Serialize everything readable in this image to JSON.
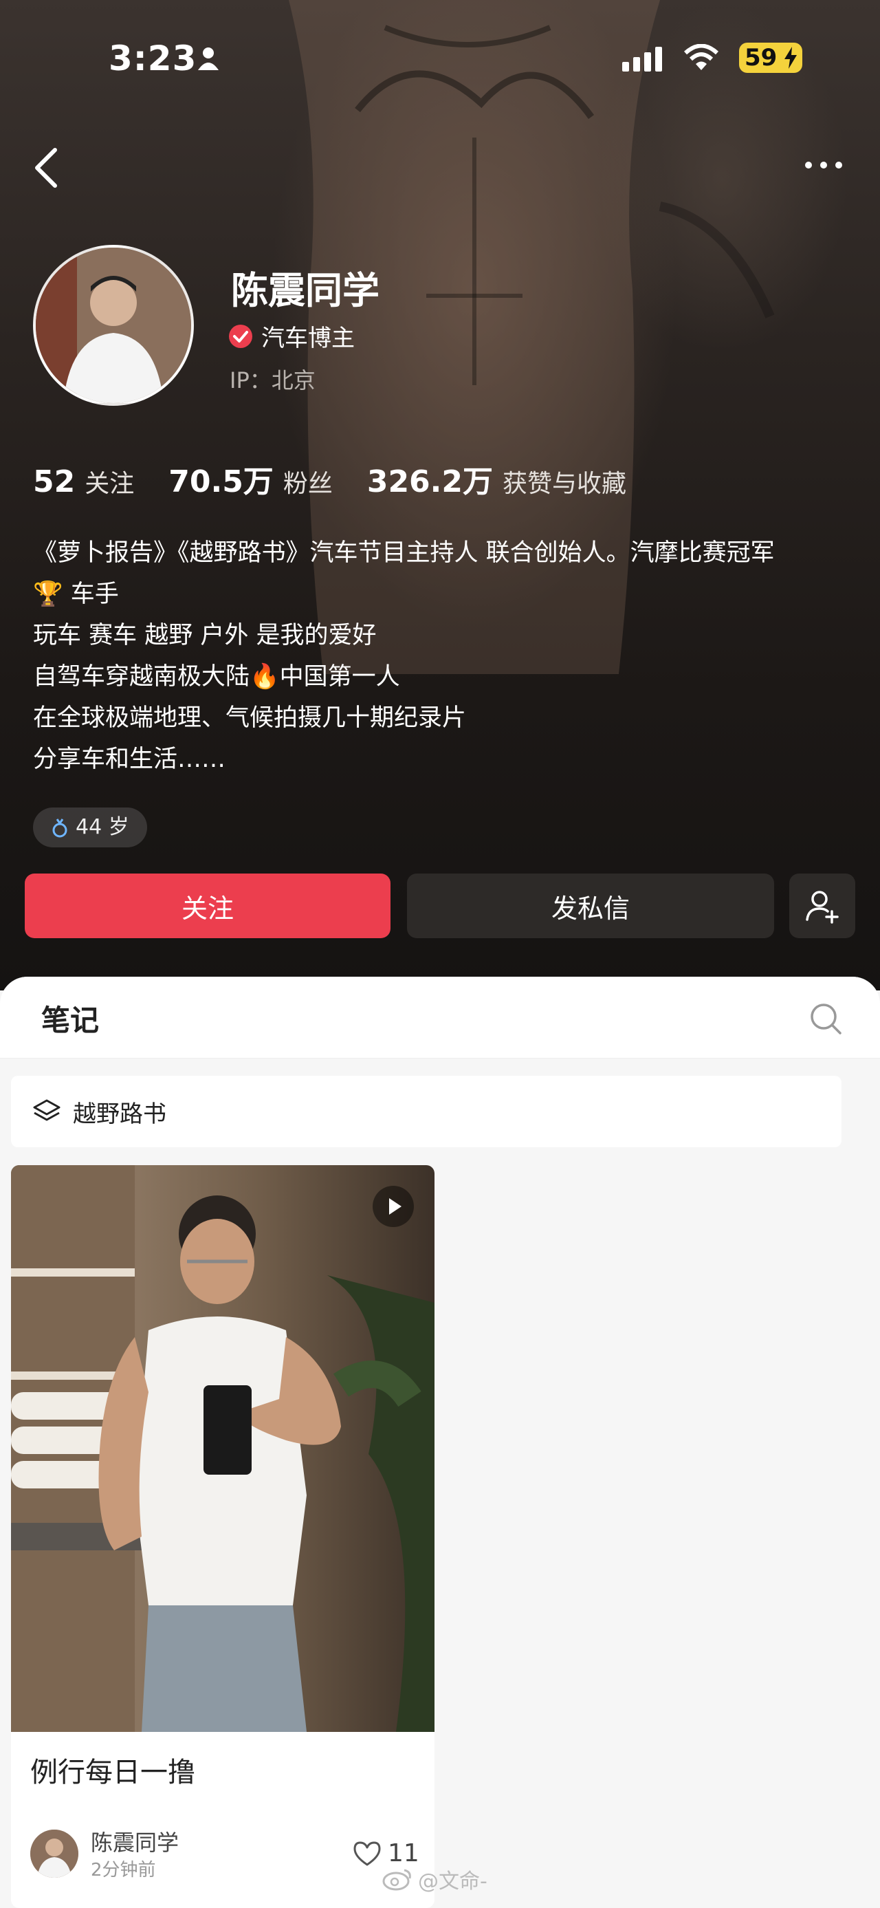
{
  "status_bar": {
    "time": "3:23",
    "battery": "59"
  },
  "profile": {
    "name": "陈震同学",
    "badge": "汽车博主",
    "ip": "IP：北京",
    "stats": [
      {
        "value": "52",
        "label": "关注"
      },
      {
        "value": "70.5万",
        "label": "粉丝"
      },
      {
        "value": "326.2万",
        "label": "获赞与收藏"
      }
    ],
    "bio": [
      "《萝卜报告》《越野路书》汽车节目主持人 联合创始人。汽摩比赛冠军",
      "🏆 车手",
      "玩车 赛车 越野 户外 是我的爱好",
      "自驾车穿越南极大陆🔥中国第一人",
      "在全球极端地理、气候拍摄几十期纪录片",
      "分享车和生活……"
    ],
    "age": "44 岁"
  },
  "actions": {
    "follow": "关注",
    "message": "发私信"
  },
  "tabs": {
    "notes": "笔记"
  },
  "album": {
    "name": "越野路书"
  },
  "note_card": {
    "title": "例行每日一撸",
    "author": "陈震同学",
    "time": "2分钟前",
    "likes": "11"
  },
  "watermark": "@文命-",
  "colors": {
    "accent": "#ec3e4e",
    "battery": "#f4d23c"
  }
}
